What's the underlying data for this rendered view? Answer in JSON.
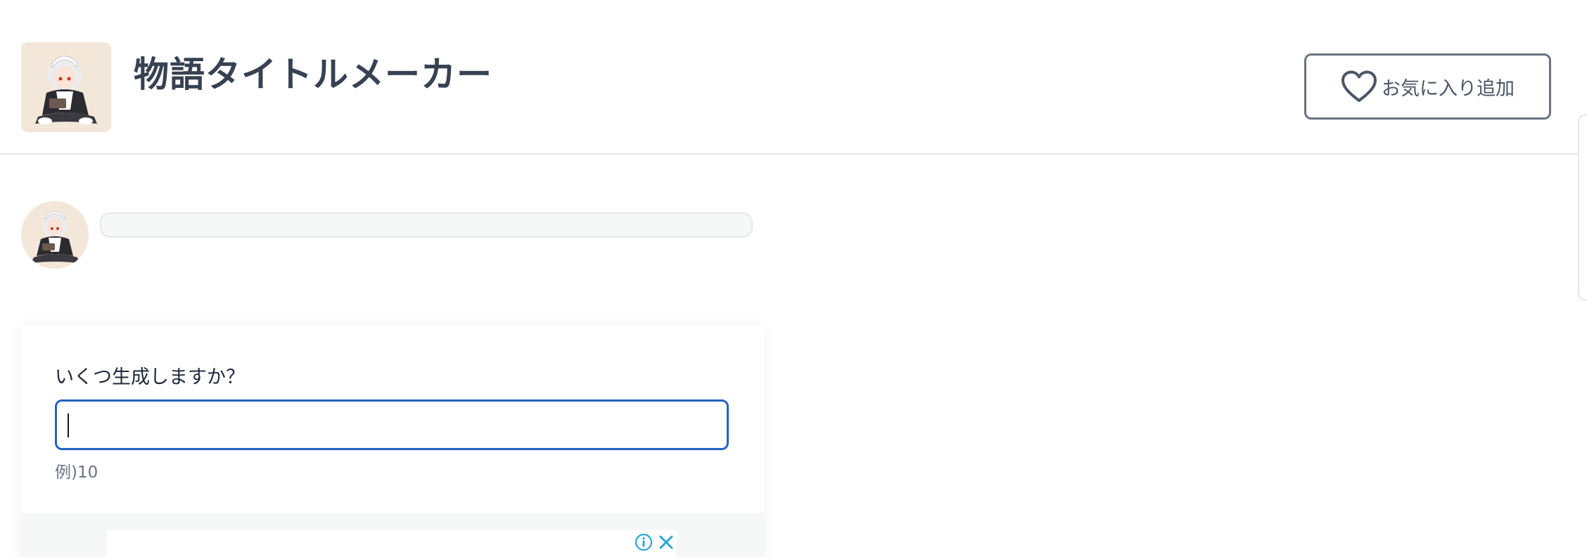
{
  "header": {
    "title": "物語タイトルメーカー",
    "favorite_button_label": "お気に入り追加"
  },
  "form": {
    "question": "いくつ生成しますか？",
    "input_value": "",
    "hint": "例)10"
  },
  "icons": {
    "favorite": "heart-icon",
    "ad_info": "info-icon",
    "ad_close": "close-icon"
  },
  "colors": {
    "title_text": "#374151",
    "input_focus_border": "#2563c4",
    "ad_icon": "#2aa6d6"
  }
}
